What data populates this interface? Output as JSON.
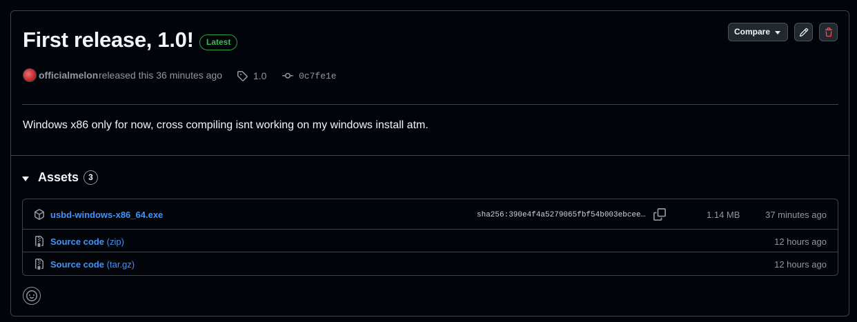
{
  "release": {
    "title": "First release, 1.0!",
    "badge": "Latest",
    "author": "officialmelon",
    "released_text": "released this 36 minutes ago",
    "tag": "1.0",
    "commit": "0c7fe1e",
    "body": "Windows x86 only for now, cross compiling isnt working on my windows install atm."
  },
  "toolbar": {
    "compare_label": "Compare",
    "edit_icon": "pencil-icon",
    "delete_icon": "trash-icon"
  },
  "assets": {
    "title": "Assets",
    "count": "3",
    "items": [
      {
        "name": "usbd-windows-x86_64.exe",
        "icon": "package-icon",
        "sha": "sha256:390e4f4a5279065fbf54b003ebcee…",
        "size": "1.14 MB",
        "time": "37 minutes ago"
      },
      {
        "name": "Source code",
        "suffix": "(zip)",
        "icon": "file-zip-icon",
        "time": "12 hours ago"
      },
      {
        "name": "Source code",
        "suffix": "(tar.gz)",
        "icon": "file-zip-icon",
        "time": "12 hours ago"
      }
    ]
  },
  "colors": {
    "background": "#010409",
    "border": "#3d444d",
    "link": "#4493f8",
    "success": "#3fb950",
    "danger": "#f85149"
  }
}
